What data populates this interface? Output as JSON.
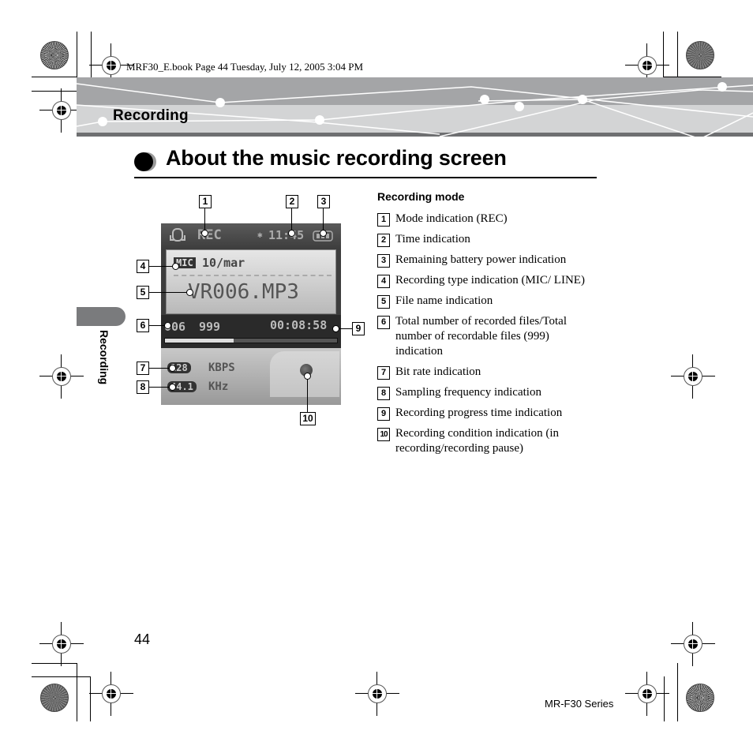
{
  "book_header": "MRF30_E.book  Page 44  Tuesday, July 12, 2005  3:04 PM",
  "section": "Recording",
  "side_tab_label": "Recording",
  "title": "About the music recording screen",
  "device_screen": {
    "mode": "REC",
    "time": "11:45",
    "recording_type": "MIC",
    "date": "10/mar",
    "filename": "VR006.MP3",
    "file_count": "006",
    "file_max": "999",
    "elapsed": "00:08:58",
    "progress_fraction": 0.4,
    "bitrate_value": "128",
    "bitrate_unit": "KBPS",
    "sampling_value": "44.1",
    "sampling_unit": "KHz"
  },
  "callouts": [
    "1",
    "2",
    "3",
    "4",
    "5",
    "6",
    "7",
    "8",
    "9",
    "10"
  ],
  "legend": {
    "heading": "Recording mode",
    "items": [
      {
        "num": "1",
        "text": "Mode indication (REC)"
      },
      {
        "num": "2",
        "text": "Time indication"
      },
      {
        "num": "3",
        "text": "Remaining battery power indication"
      },
      {
        "num": "4",
        "text": "Recording type indication (MIC/ LINE)"
      },
      {
        "num": "5",
        "text": "File name indication"
      },
      {
        "num": "6",
        "text": "Total number of recorded files/Total number of recordable files (999) indication"
      },
      {
        "num": "7",
        "text": "Bit rate indication"
      },
      {
        "num": "8",
        "text": "Sampling frequency indication"
      },
      {
        "num": "9",
        "text": "Recording progress time indication"
      },
      {
        "num": "10",
        "text": "Recording condition indication (in recording/recording pause)"
      }
    ]
  },
  "page_number": "44",
  "series": "MR-F30 Series"
}
